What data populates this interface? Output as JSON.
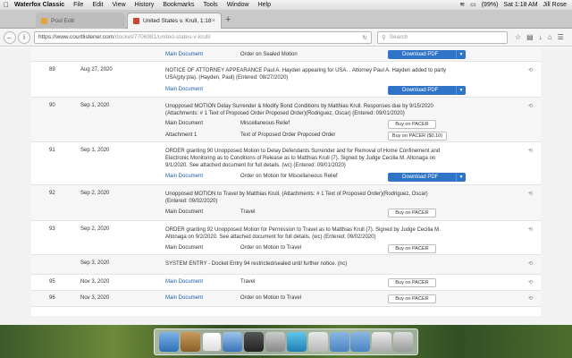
{
  "menubar": {
    "app": "Waterfox Classic",
    "items": [
      "File",
      "Edit",
      "View",
      "History",
      "Bookmarks",
      "Tools",
      "Window",
      "Help"
    ],
    "battery": "(99%)",
    "clock": "Sat 1:18 AM",
    "user": "Jill Rose"
  },
  "tabs": [
    {
      "label": "Post Edit",
      "active": false
    },
    {
      "label": "United States v. Krull, 1:18",
      "active": true
    }
  ],
  "nav": {
    "url_host": "https://www.courtlistener.com",
    "url_path": "/docket/7706981/united-states-v-krull/",
    "search_placeholder": "Search"
  },
  "top_partial": {
    "doc": "Main Document",
    "desc": "Order on Sealed Motion",
    "button": "Download PDF"
  },
  "entries": [
    {
      "num": "89",
      "date": "Aug 27, 2020",
      "desc": "NOTICE OF ATTORNEY APPEARANCE Paul A. Hayden appearing for USA. . Attorney Paul A. Hayden added to party USA(pty:pla). (Hayden, Paul) (Entered: 08/27/2020)",
      "subs": [
        {
          "doc": "Main Document",
          "desc": "",
          "button": "Download PDF",
          "type": "download"
        }
      ]
    },
    {
      "num": "90",
      "date": "Sep 1, 2020",
      "desc": "Unopposed MOTION Delay Surrender & Modify Bond Conditions by Matthias Krull. Responses due by 9/15/2020 (Attachments: # 1 Text of Proposed Order Proposed Order)(Rodriguez, Oscar) (Entered: 09/01/2020)",
      "subs": [
        {
          "doc": "Main Document",
          "desc": "Miscellaneous Relief",
          "button": "Buy on PACER",
          "type": "pacer"
        },
        {
          "doc": "Attachment 1",
          "desc": "Text of Proposed Order Proposed Order",
          "button": "Buy on PACER ($0.10)",
          "type": "pacer"
        }
      ]
    },
    {
      "num": "91",
      "date": "Sep 1, 2020",
      "desc": "ORDER granting 90 Unopposed Motion to Delay Defendants Surrender and for Removal of Home Confinement and Electronic Monitoring as to Conditions of Release as to Matthias Krull (7). Signed by Judge Cecilia M. Altonaga on 9/1/2020. See attached document for full details. (wc) (Entered: 09/01/2020)",
      "subs": [
        {
          "doc": "Main Document",
          "desc": "Order on Motion for Miscellaneous Relief",
          "button": "Download PDF",
          "type": "download"
        }
      ]
    },
    {
      "num": "92",
      "date": "Sep 2, 2020",
      "desc": "Unopposed MOTION to Travel by Matthias Krull. (Attachments: # 1 Text of Proposed Order)(Rodriguez, Oscar) (Entered: 09/02/2020)",
      "subs": [
        {
          "doc": "Main Document",
          "desc": "Travel",
          "button": "Buy on PACER",
          "type": "pacer"
        }
      ]
    },
    {
      "num": "93",
      "date": "Sep 2, 2020",
      "desc": "ORDER granting 92 Unopposed Motion for Permission to Travel as to Matthias Krull (7). Signed by Judge Cecilia M. Altonaga on 9/2/2020. See attached document for full details. (wc) (Entered: 09/02/2020)",
      "subs": [
        {
          "doc": "Main Document",
          "desc": "Order on Motion to Travel",
          "button": "Buy on PACER",
          "type": "pacer"
        }
      ]
    },
    {
      "num": "",
      "date": "Sep 3, 2020",
      "desc": "SYSTEM ENTRY - Docket Entry 94 restricted/sealed until further notice. (nc)",
      "subs": []
    },
    {
      "num": "95",
      "date": "Nov 3, 2020",
      "desc": "",
      "subs": [
        {
          "doc": "Main Document",
          "desc": "Travel",
          "button": "Buy on PACER",
          "type": "pacer"
        }
      ]
    },
    {
      "num": "96",
      "date": "Nov 3, 2020",
      "desc": "",
      "subs": [
        {
          "doc": "Main Document",
          "desc": "Order on Motion to Travel",
          "button": "Buy on PACER",
          "type": "pacer"
        }
      ]
    }
  ],
  "share_icon": "share-icon",
  "colors": {
    "link": "#1a5fa6",
    "download": "#2f74c7"
  }
}
